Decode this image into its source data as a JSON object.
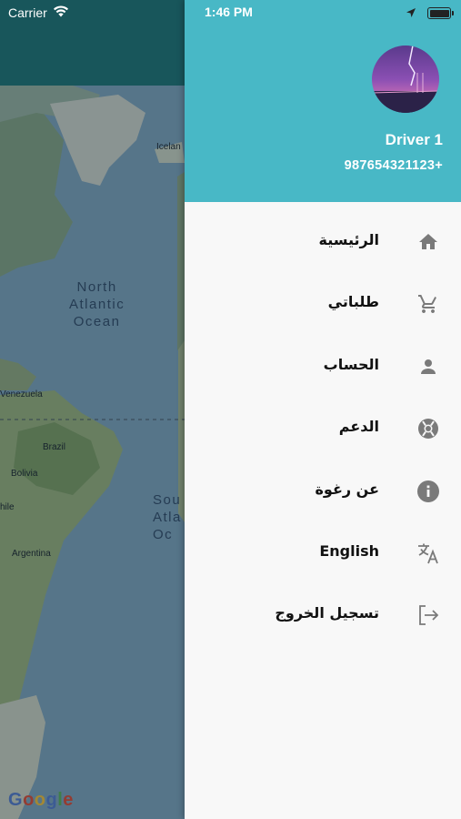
{
  "status_bar": {
    "carrier": "Carrier",
    "time": "1:46 PM"
  },
  "map": {
    "labels": {
      "north_atlantic": "North\nAtlantic\nOcean",
      "south_atlantic": "Sou\nAtla\nOc",
      "iceland": "Icelan",
      "venezuela": "Venezuela",
      "brazil": "Brazil",
      "bolivia": "Bolivia",
      "chile": "hile",
      "argentina": "Argentina"
    },
    "attribution": [
      "G",
      "o",
      "o",
      "g",
      "l",
      "e"
    ]
  },
  "drawer": {
    "header_color": "#48b8c6",
    "driver_name": "Driver 1",
    "driver_phone": "987654321123+",
    "menu": [
      {
        "id": "home",
        "label": "الرئيسية",
        "icon": "home-icon"
      },
      {
        "id": "orders",
        "label": "طلباتي",
        "icon": "cart-icon"
      },
      {
        "id": "account",
        "label": "الحساب",
        "icon": "person-icon"
      },
      {
        "id": "support",
        "label": "الدعم",
        "icon": "lifebuoy-icon"
      },
      {
        "id": "about",
        "label": "عن رغوة",
        "icon": "info-icon"
      },
      {
        "id": "language",
        "label": "English",
        "icon": "translate-icon"
      },
      {
        "id": "logout",
        "label": "تسجيل الخروج",
        "icon": "logout-icon"
      }
    ]
  },
  "colors": {
    "appbar": "#1e6a70",
    "drawer_header": "#48b8c6",
    "icon_gray": "#7a7a7a"
  }
}
